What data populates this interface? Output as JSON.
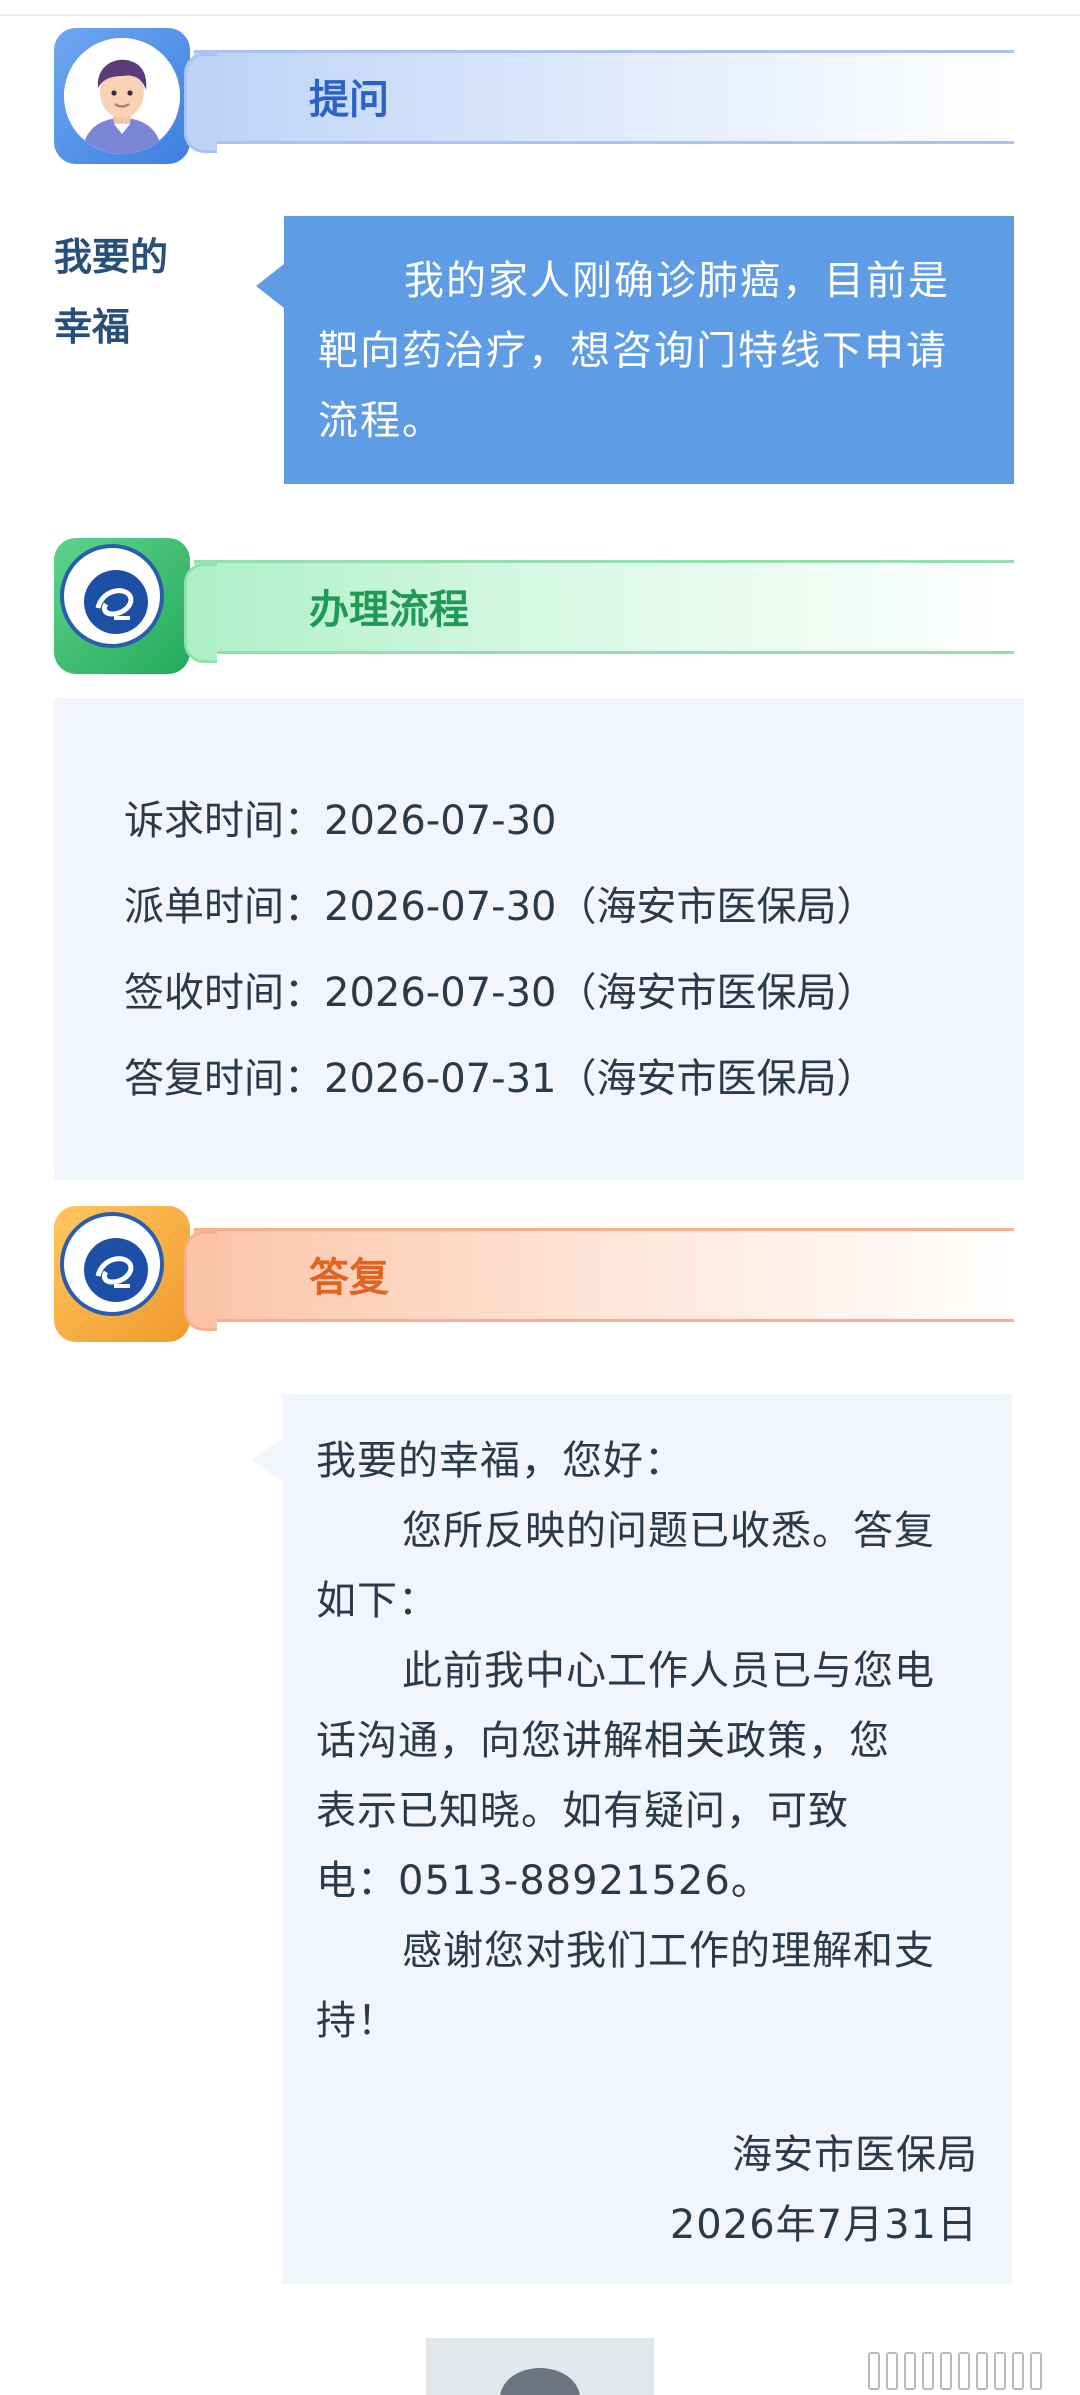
{
  "question_section": {
    "title": "提问",
    "asker": {
      "line1": "我要的",
      "line2": "幸福"
    },
    "text": "我的家人刚确诊肺癌，目前是靶向药治疗，想咨询门特线下申请流程。"
  },
  "process_section": {
    "title": "办理流程",
    "rows": [
      {
        "label": "诉求时间：",
        "value": "2026-07-30",
        "dept": ""
      },
      {
        "label": "派单时间：",
        "value": "2026-07-30",
        "dept": "（海安市医保局）"
      },
      {
        "label": "签收时间：",
        "value": "2026-07-30",
        "dept": "（海安市医保局）"
      },
      {
        "label": "答复时间：",
        "value": "2026-07-31",
        "dept": "（海安市医保局）"
      }
    ]
  },
  "reply_section": {
    "title": "答复",
    "greeting": "我要的幸福，您好：",
    "para1a": "您所反映的问题已收悉。答复",
    "para1b": "如下：",
    "para2a": "此前我中心工作人员已与您电",
    "para2b": "话沟通，向您讲解相关政策，您",
    "para2c": "表示已知晓。如有疑问，可致",
    "para2d": "电：0513-88921526。",
    "para3a": "感谢您对我们工作的理解和支",
    "para3b": "持！",
    "signature": "海安市医保局",
    "date": "2026年7月31日"
  },
  "icons": {
    "question": "user-avatar-icon",
    "process": "service-emblem-icon",
    "reply": "service-emblem-icon"
  },
  "colors": {
    "question_accent": "#2a62c9",
    "process_accent": "#1f9a55",
    "reply_accent": "#e2641e",
    "bubble_blue": "#5e9ce6"
  }
}
